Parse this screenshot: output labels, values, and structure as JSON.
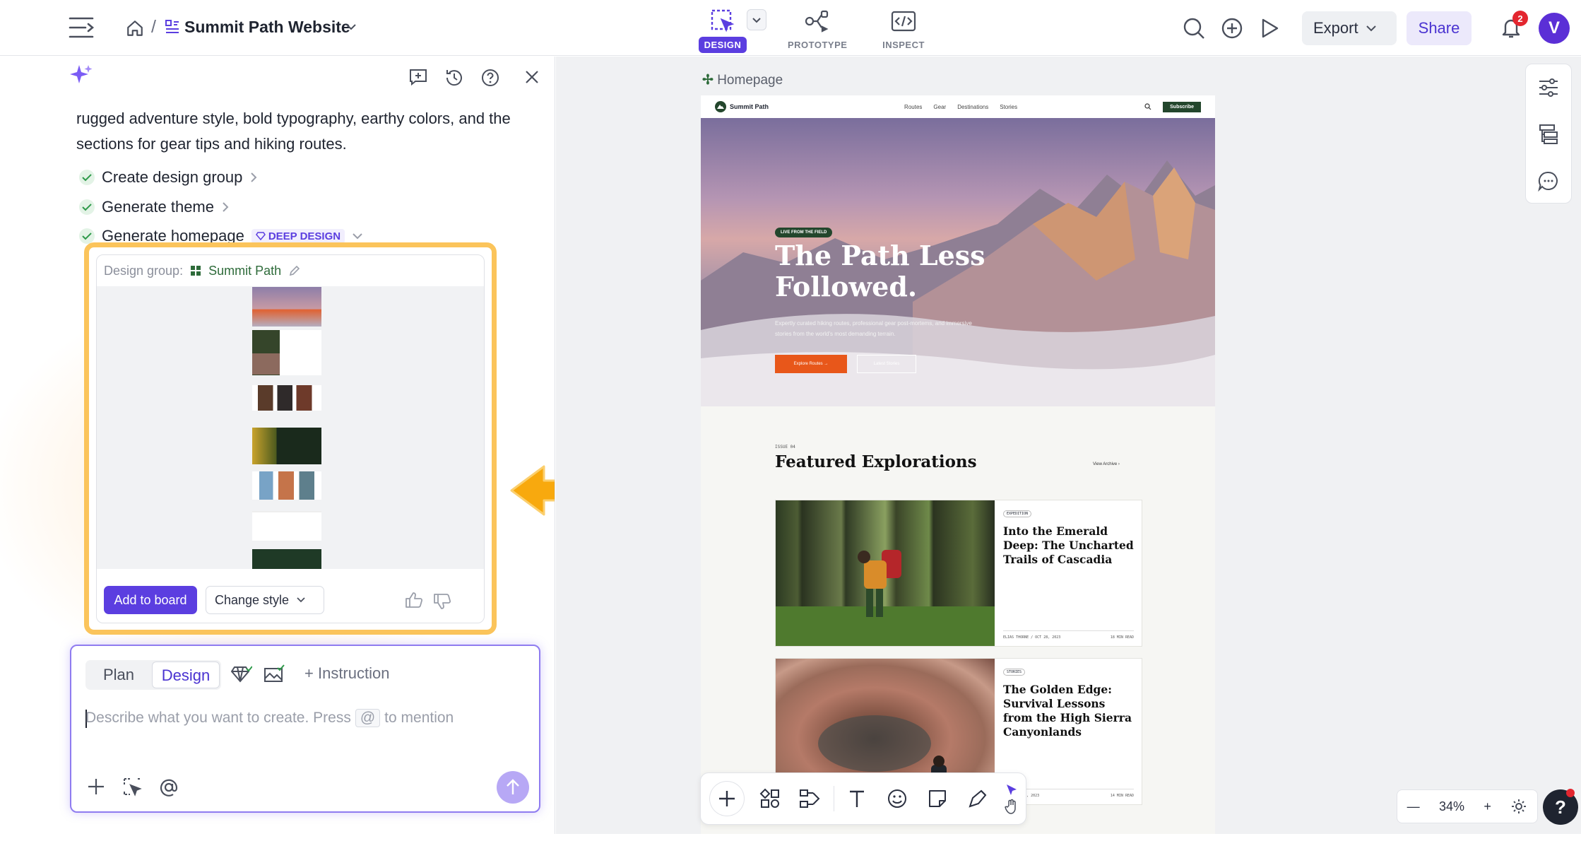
{
  "topbar": {
    "project_name": "Summit Path Website",
    "breadcrumb_sep": "/",
    "modes": [
      {
        "label": "DESIGN",
        "active": true
      },
      {
        "label": "PROTOTYPE",
        "active": false
      },
      {
        "label": "INSPECT",
        "active": false
      }
    ],
    "export_label": "Export",
    "share_label": "Share",
    "notification_count": "2",
    "avatar_letter": "V",
    "accent_color": "#5b3ee0"
  },
  "chat": {
    "message": "rugged adventure style, bold typography, earthy colors, and the sections for gear tips and hiking routes.",
    "steps": [
      {
        "label": "Create design group"
      },
      {
        "label": "Generate theme"
      },
      {
        "label": "Generate homepage",
        "badge": "DEEP DESIGN"
      }
    ],
    "card": {
      "group_label": "Design group:",
      "group_name": "Summit Path",
      "add_button": "Add to board",
      "style_button": "Change style"
    }
  },
  "composer": {
    "tabs": [
      "Plan",
      "Design"
    ],
    "active_tab": "Design",
    "instruction_label": "Instruction",
    "placeholder_a": "Describe what you want to create. Press",
    "placeholder_key": "@",
    "placeholder_b": "to mention"
  },
  "canvas": {
    "page_label": "Homepage",
    "zoom": "34%"
  },
  "site": {
    "brand": "Summit Path",
    "nav": [
      "Routes",
      "Gear",
      "Destinations",
      "Stories"
    ],
    "subscribe": "Subscribe",
    "hero_tag": "LIVE FROM THE FIELD",
    "hero_title": "The Path Less Followed.",
    "hero_sub": "Expertly curated hiking routes, professional gear post-mortems, and immersive stories from the world's most demanding terrain.",
    "hero_btn_primary": "Explore Routes →",
    "hero_btn_secondary": "Latest Stories",
    "issue": "ISSUE 04",
    "featured_title": "Featured Explorations",
    "view_archive": "View Archive ›",
    "articles": [
      {
        "tag": "EXPEDITION",
        "title": "Into the Emerald Deep: The Uncharted Trails of Cascadia",
        "meta_left": "ELIAS THORNE / OCT 28, 2023",
        "meta_right": "18 MIN READ"
      },
      {
        "tag": "STORIES",
        "title": "The Golden Edge: Survival Lessons from the High Sierra Canyonlands",
        "meta_left": "ER / OCT 21, 2023",
        "meta_right": "14 MIN READ"
      }
    ]
  }
}
